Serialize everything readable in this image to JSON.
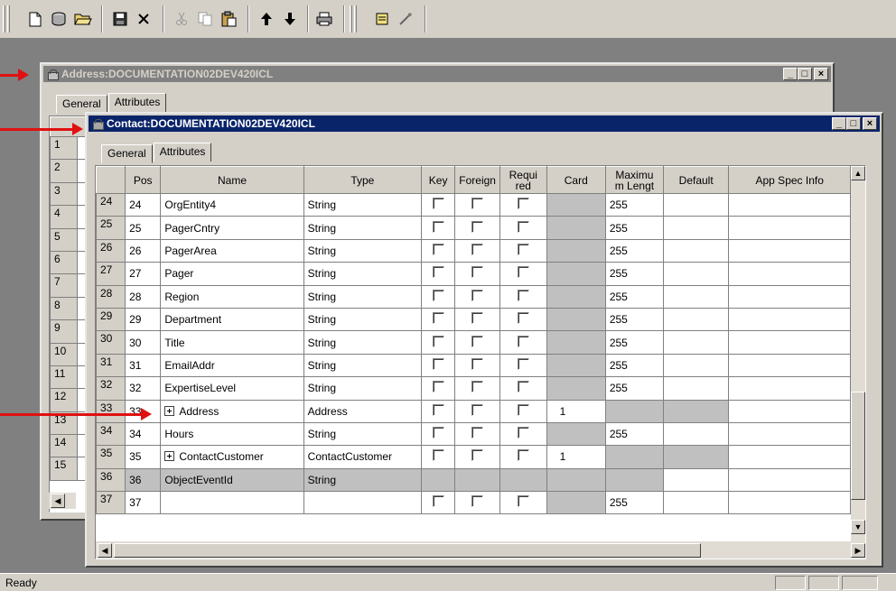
{
  "toolbar": {
    "icons": [
      "new-icon",
      "open-db-icon",
      "open-folder-icon",
      "save-icon",
      "delete-icon",
      "cut-icon",
      "copy-icon",
      "paste-icon",
      "move-up-icon",
      "move-down-icon",
      "print-icon",
      "properties-icon",
      "wand-icon"
    ]
  },
  "status": {
    "text": "Ready"
  },
  "address_window": {
    "title": "Address:DOCUMENTATION02DEV420ICL",
    "tabs": [
      "General",
      "Attributes"
    ],
    "row_numbers": [
      "1",
      "2",
      "3",
      "4",
      "5",
      "6",
      "7",
      "8",
      "9",
      "10",
      "11",
      "12",
      "13",
      "14",
      "15"
    ]
  },
  "contact_window": {
    "title": "Contact:DOCUMENTATION02DEV420ICL",
    "tabs": [
      "General",
      "Attributes"
    ],
    "columns": [
      "",
      "Pos",
      "Name",
      "Type",
      "Key",
      "Foreign",
      "Requi red",
      "Card",
      "Maximu m Lengt",
      "Default",
      "App Spec Info"
    ],
    "rows": [
      {
        "row": "24",
        "pos": "24",
        "name": "OrgEntity4",
        "type": "String",
        "checks": true,
        "card": "",
        "max": "255",
        "expandable": false,
        "shaded": false
      },
      {
        "row": "25",
        "pos": "25",
        "name": "PagerCntry",
        "type": "String",
        "checks": true,
        "card": "",
        "max": "255",
        "expandable": false,
        "shaded": false
      },
      {
        "row": "26",
        "pos": "26",
        "name": "PagerArea",
        "type": "String",
        "checks": true,
        "card": "",
        "max": "255",
        "expandable": false,
        "shaded": false
      },
      {
        "row": "27",
        "pos": "27",
        "name": "Pager",
        "type": "String",
        "checks": true,
        "card": "",
        "max": "255",
        "expandable": false,
        "shaded": false
      },
      {
        "row": "28",
        "pos": "28",
        "name": "Region",
        "type": "String",
        "checks": true,
        "card": "",
        "max": "255",
        "expandable": false,
        "shaded": false
      },
      {
        "row": "29",
        "pos": "29",
        "name": "Department",
        "type": "String",
        "checks": true,
        "card": "",
        "max": "255",
        "expandable": false,
        "shaded": false
      },
      {
        "row": "30",
        "pos": "30",
        "name": "Title",
        "type": "String",
        "checks": true,
        "card": "",
        "max": "255",
        "expandable": false,
        "shaded": false
      },
      {
        "row": "31",
        "pos": "31",
        "name": "EmailAddr",
        "type": "String",
        "checks": true,
        "card": "",
        "max": "255",
        "expandable": false,
        "shaded": false
      },
      {
        "row": "32",
        "pos": "32",
        "name": "ExpertiseLevel",
        "type": "String",
        "checks": true,
        "card": "",
        "max": "255",
        "expandable": false,
        "shaded": false
      },
      {
        "row": "33",
        "pos": "33",
        "name": "Address",
        "type": "Address",
        "checks": true,
        "card": "1",
        "max": "",
        "expandable": true,
        "shaded": false
      },
      {
        "row": "34",
        "pos": "34",
        "name": "Hours",
        "type": "String",
        "checks": true,
        "card": "",
        "max": "255",
        "expandable": false,
        "shaded": false
      },
      {
        "row": "35",
        "pos": "35",
        "name": "ContactCustomer",
        "type": "ContactCustomer",
        "checks": true,
        "card": "1",
        "max": "",
        "expandable": true,
        "shaded": false
      },
      {
        "row": "36",
        "pos": "36",
        "name": "ObjectEventId",
        "type": "String",
        "checks": false,
        "card": "",
        "max": "",
        "expandable": false,
        "shaded": true
      },
      {
        "row": "37",
        "pos": "37",
        "name": "",
        "type": "",
        "checks": true,
        "card": "",
        "max": "255",
        "expandable": false,
        "shaded": false
      }
    ]
  },
  "colors": {
    "active_title": "#0a246a",
    "inactive_title": "#808080",
    "arrow": "#e01010",
    "face": "#d4d0c8"
  }
}
